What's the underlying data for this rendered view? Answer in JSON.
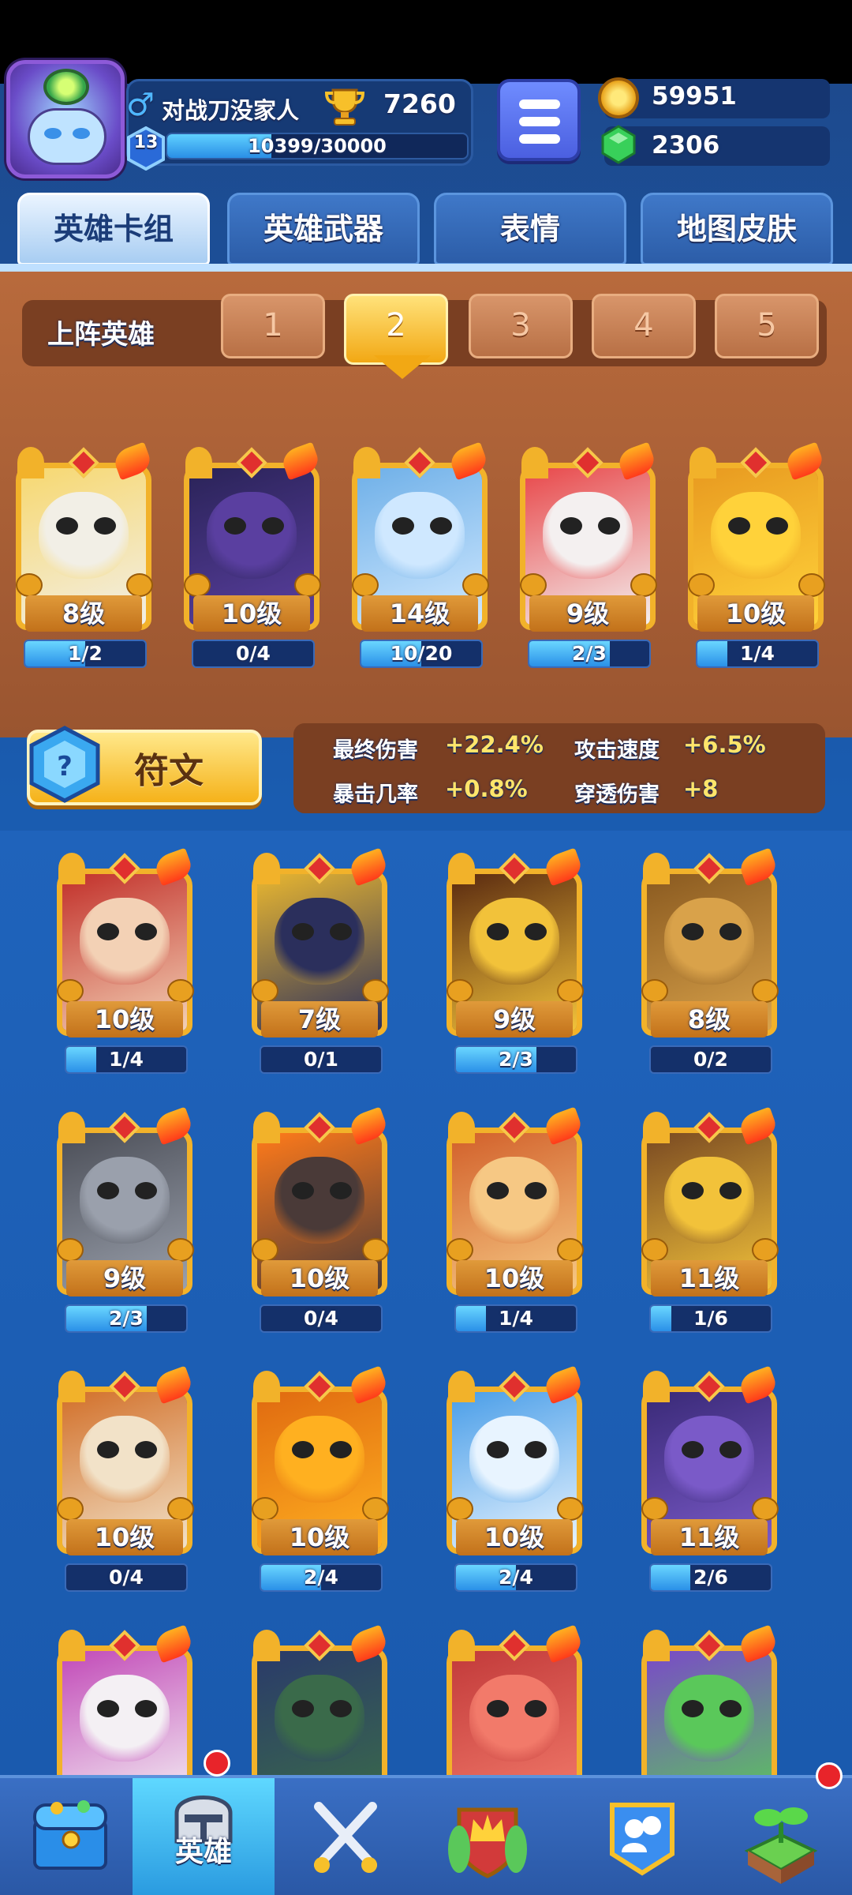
{
  "player": {
    "name": "对战刀没家人",
    "gender_symbol": "♂",
    "trophies": "7260",
    "level": "13",
    "xp_text": "10399/30000",
    "xp_fraction": 0.3466
  },
  "currency": {
    "gold": "59951",
    "gems": "2306"
  },
  "tabs": [
    {
      "label": "英雄卡组",
      "active": true
    },
    {
      "label": "英雄武器",
      "active": false
    },
    {
      "label": "表情",
      "active": false
    },
    {
      "label": "地图皮肤",
      "active": false
    }
  ],
  "lineup": {
    "label": "上阵英雄",
    "slots": [
      "1",
      "2",
      "3",
      "4",
      "5"
    ],
    "active_slot": "2"
  },
  "team_cards": [
    {
      "hero": "ghost",
      "level": "8级",
      "progress": "1/2",
      "fill": 0.5,
      "colors": [
        "#f2efe6",
        "#f7d870"
      ]
    },
    {
      "hero": "dark-wizard",
      "level": "10级",
      "progress": "0/4",
      "fill": 0,
      "colors": [
        "#5a3fa0",
        "#2a2358"
      ]
    },
    {
      "hero": "zeus",
      "level": "14级",
      "progress": "10/20",
      "fill": 0.5,
      "colors": [
        "#cfe8ff",
        "#6fb0e8"
      ]
    },
    {
      "hero": "clown",
      "level": "9级",
      "progress": "2/3",
      "fill": 0.67,
      "colors": [
        "#f4f0f0",
        "#e8484a"
      ]
    },
    {
      "hero": "chef",
      "level": "10级",
      "progress": "1/4",
      "fill": 0.25,
      "colors": [
        "#ffd23a",
        "#e89a20"
      ]
    }
  ],
  "rune": {
    "label": "符文"
  },
  "stats": [
    {
      "label": "最终伤害",
      "value": "+22.4%"
    },
    {
      "label": "攻击速度",
      "value": "+6.5%"
    },
    {
      "label": "暴击几率",
      "value": "+0.8%"
    },
    {
      "label": "穿透伤害",
      "value": "+8"
    }
  ],
  "collection": [
    {
      "hero": "fan-girl",
      "level": "10级",
      "progress": "1/4",
      "fill": 0.25,
      "colors": [
        "#f3d1b5",
        "#c2302a"
      ]
    },
    {
      "hero": "pharaoh",
      "level": "7级",
      "progress": "0/1",
      "fill": 0,
      "colors": [
        "#2b2f5c",
        "#e8b630"
      ]
    },
    {
      "hero": "hooded-monk",
      "level": "9级",
      "progress": "2/3",
      "fill": 0.67,
      "colors": [
        "#f2c23a",
        "#5a2a10"
      ]
    },
    {
      "hero": "tree-spirit",
      "level": "8级",
      "progress": "0/2",
      "fill": 0,
      "colors": [
        "#d9a24a",
        "#8a5a20"
      ]
    },
    {
      "hero": "knight",
      "level": "9级",
      "progress": "2/3",
      "fill": 0.67,
      "colors": [
        "#9aa0ac",
        "#4c4f58"
      ]
    },
    {
      "hero": "lava-golem",
      "level": "10级",
      "progress": "0/4",
      "fill": 0,
      "colors": [
        "#4a3a38",
        "#ff7a1a"
      ]
    },
    {
      "hero": "monkey-king",
      "level": "10级",
      "progress": "1/4",
      "fill": 0.25,
      "colors": [
        "#f6c884",
        "#d2602a"
      ]
    },
    {
      "hero": "cowboy",
      "level": "11级",
      "progress": "1/6",
      "fill": 0.17,
      "colors": [
        "#f2c23a",
        "#7a4a22"
      ]
    },
    {
      "hero": "sage",
      "level": "10级",
      "progress": "0/4",
      "fill": 0,
      "colors": [
        "#f2e2c8",
        "#d2702a"
      ]
    },
    {
      "hero": "mustache-ball",
      "level": "10级",
      "progress": "2/4",
      "fill": 0.5,
      "colors": [
        "#ffb020",
        "#e06a10"
      ]
    },
    {
      "hero": "yeti",
      "level": "10级",
      "progress": "2/4",
      "fill": 0.5,
      "colors": [
        "#e8f4ff",
        "#4a9ee8"
      ]
    },
    {
      "hero": "octopus-pirate",
      "level": "11级",
      "progress": "2/6",
      "fill": 0.33,
      "colors": [
        "#7a5ac8",
        "#3a2a78"
      ]
    },
    {
      "hero": "skull-ghost",
      "level": "",
      "progress": "",
      "fill": 0,
      "colors": [
        "#f4f0f4",
        "#c24ab8"
      ]
    },
    {
      "hero": "police",
      "level": "",
      "progress": "",
      "fill": 0,
      "colors": [
        "#3a6a4a",
        "#2a3a6a"
      ]
    },
    {
      "hero": "red-dancer",
      "level": "",
      "progress": "",
      "fill": 0,
      "colors": [
        "#f27a6a",
        "#c23a3a"
      ]
    },
    {
      "hero": "zombie-robot",
      "level": "",
      "progress": "",
      "fill": 0,
      "colors": [
        "#5ac85a",
        "#7a4ac8"
      ]
    }
  ],
  "nav": [
    {
      "icon": "treasure-chest-icon",
      "label": ""
    },
    {
      "icon": "knight-helmet-icon",
      "label": "英雄",
      "active": true
    },
    {
      "icon": "crossed-swords-icon",
      "label": ""
    },
    {
      "icon": "crown-shield-icon",
      "label": ""
    },
    {
      "icon": "guild-icon",
      "label": ""
    },
    {
      "icon": "sprout-icon",
      "label": ""
    }
  ]
}
